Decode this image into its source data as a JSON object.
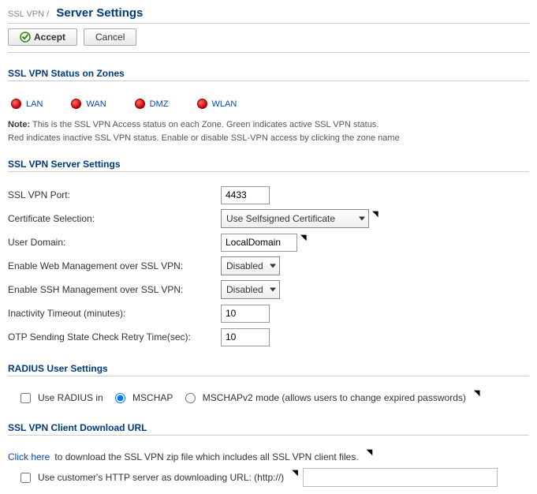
{
  "breadcrumb": {
    "parent": "SSL VPN /",
    "current": "Server Settings"
  },
  "toolbar": {
    "accept": "Accept",
    "cancel": "Cancel"
  },
  "sections": {
    "zones_title": "SSL VPN Status on Zones",
    "server_title": "SSL VPN Server Settings",
    "radius_title": "RADIUS User Settings",
    "download_title": "SSL VPN Client Download URL"
  },
  "zones": [
    "LAN",
    "WAN",
    "DMZ",
    "WLAN"
  ],
  "note": {
    "label": "Note:",
    "line1": "This is the SSL VPN Access status on each Zone. Green indicates active SSL VPN status.",
    "line2": "Red indicates inactive SSL VPN status. Enable or disable SSL-VPN access by clicking the zone name"
  },
  "server": {
    "port_label": "SSL VPN Port:",
    "port_value": "4433",
    "cert_label": "Certificate Selection:",
    "cert_value": "Use Selfsigned Certificate",
    "domain_label": "User Domain:",
    "domain_value": "LocalDomain",
    "web_mgmt_label": "Enable Web Management over SSL VPN:",
    "web_mgmt_value": "Disabled",
    "ssh_mgmt_label": "Enable SSH Management over SSL VPN:",
    "ssh_mgmt_value": "Disabled",
    "inactivity_label": "Inactivity Timeout (minutes):",
    "inactivity_value": "10",
    "otp_label": "OTP Sending State Check Retry Time(sec):",
    "otp_value": "10"
  },
  "radius": {
    "use_label": "Use RADIUS in",
    "opt1": "MSCHAP",
    "opt2": "MSCHAPv2 mode (allows users to change expired passwords)"
  },
  "download": {
    "link": "Click here",
    "text": " to download the SSL VPN zip file which includes all SSL VPN client files.",
    "http_label": "Use customer's HTTP server as downloading URL: (http://)",
    "http_value": ""
  }
}
